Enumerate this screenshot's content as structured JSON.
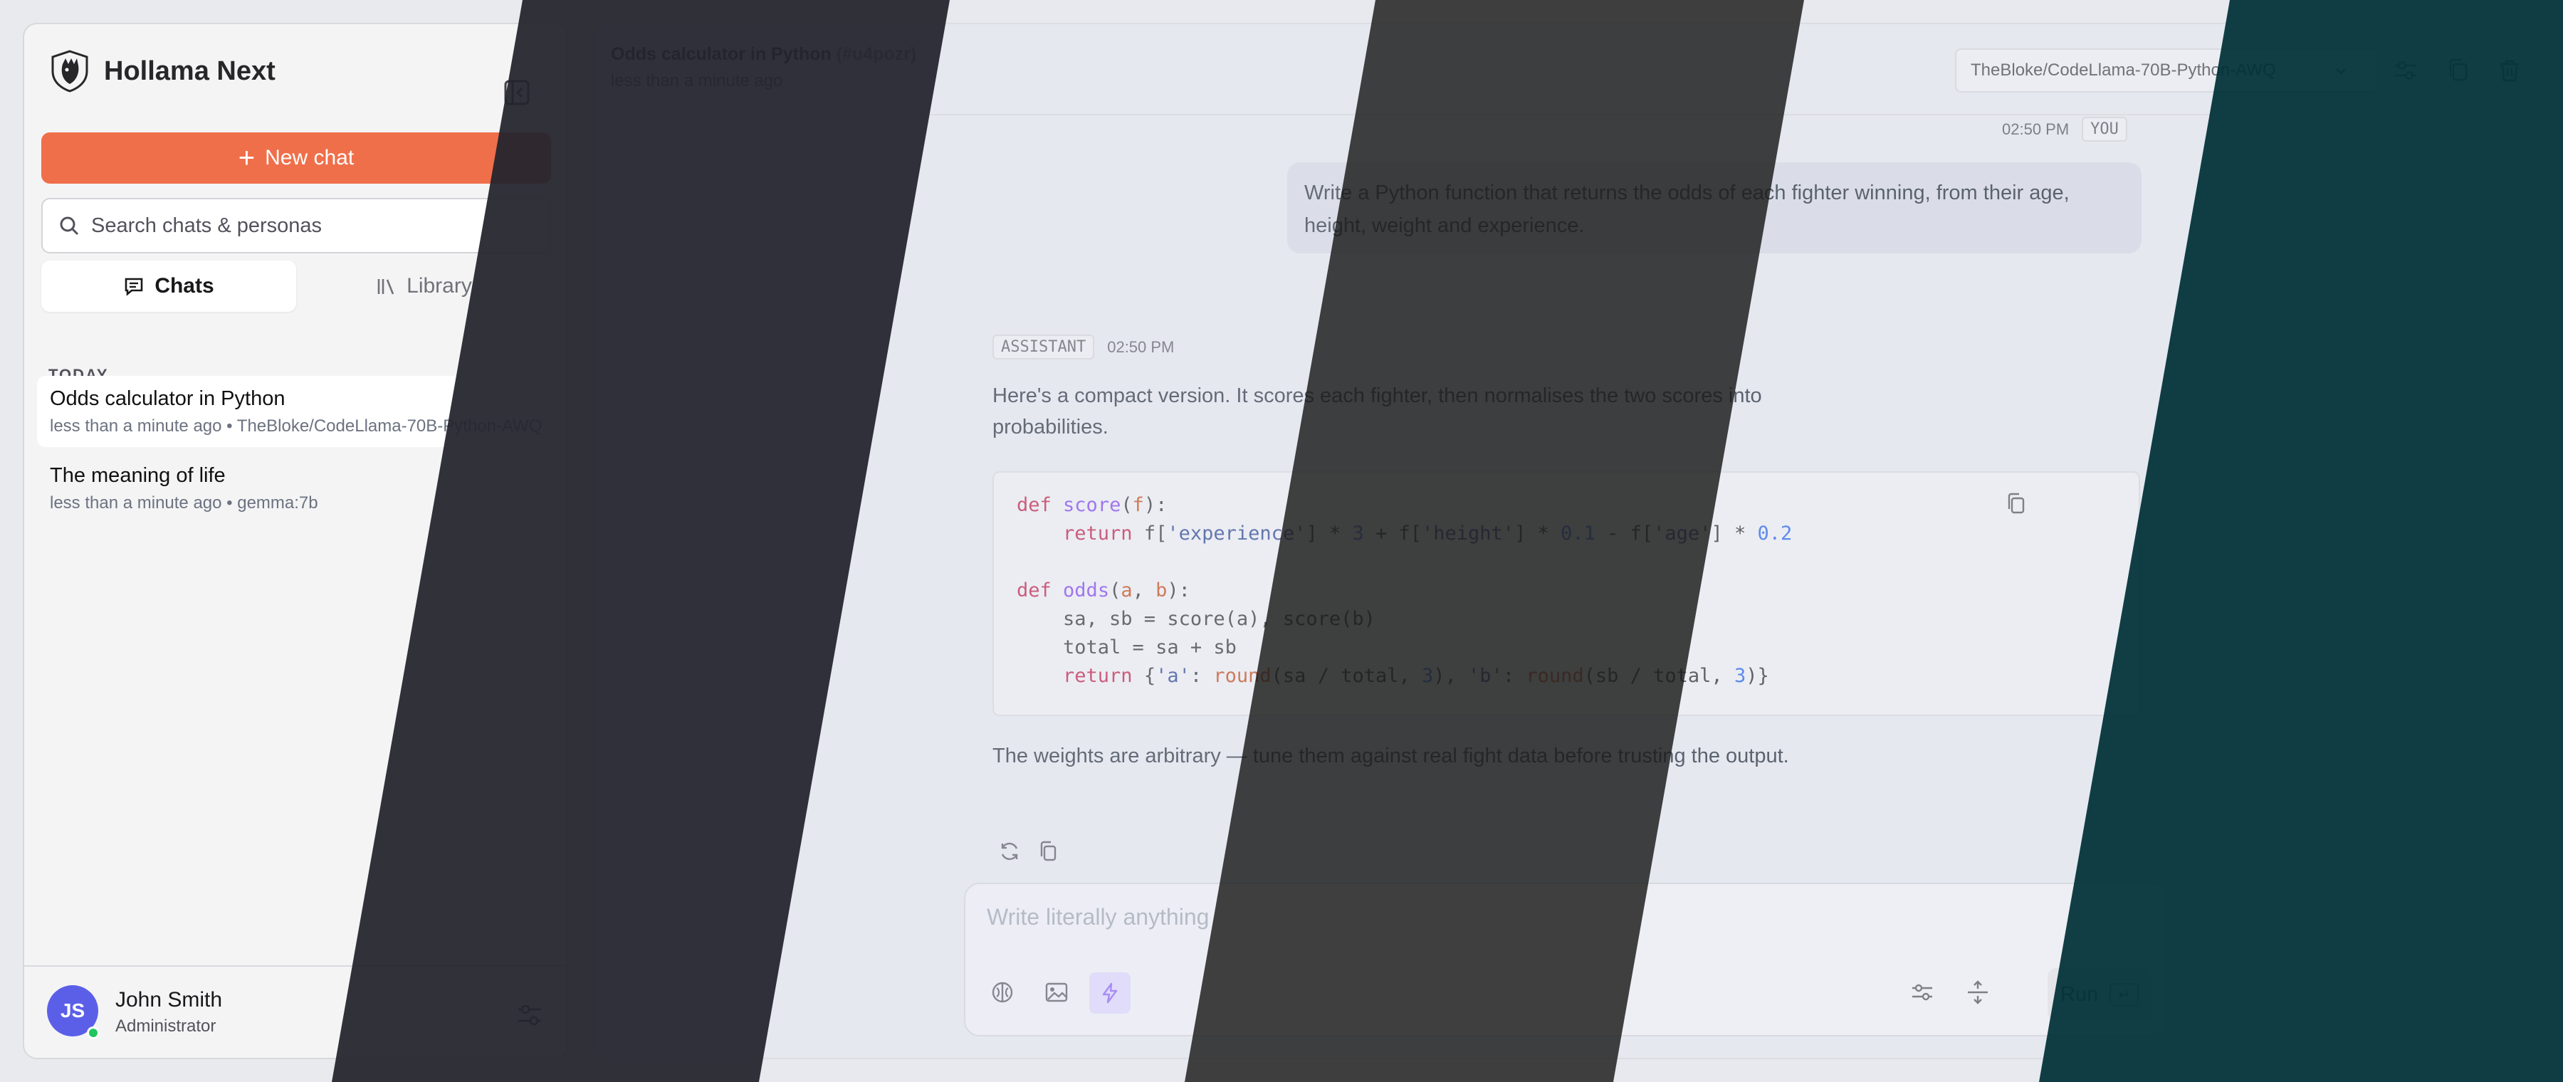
{
  "app": {
    "name": "Hollama Next"
  },
  "sidebar": {
    "new_chat_label": "New chat",
    "search_placeholder": "Search chats & personas",
    "tabs": [
      {
        "label": "Chats"
      },
      {
        "label": "Library"
      }
    ],
    "section_label": "TODAY",
    "chats": [
      {
        "title": "Odds calculator in Python",
        "subtitle": "less than a minute ago • TheBloke/CodeLlama-70B-Python-AWQ"
      },
      {
        "title": "The meaning of life",
        "subtitle": "less than a minute ago • gemma:7b"
      }
    ],
    "user": {
      "initials": "JS",
      "name": "John Smith",
      "role": "Administrator"
    }
  },
  "main": {
    "chat_title": "Odds calculator in Python",
    "chat_id": "(#u4pozr)",
    "chat_time": "less than a minute ago",
    "model": "TheBloke/CodeLlama-70B-Python-AWQ",
    "messages": {
      "user": {
        "time": "02:50 PM",
        "role": "YOU",
        "text": "Write a Python function that returns the odds of each fighter winning, from their age, height, weight and experience."
      },
      "assistant": {
        "role": "ASSISTANT",
        "time": "02:50 PM",
        "intro": "Here's a compact version. It scores each fighter, then normalises the two scores into probabilities.",
        "outro": "The weights are arbitrary — tune them against real fight data before trusting the output."
      }
    },
    "composer": {
      "placeholder": "Write literally anything",
      "run_label": "Run",
      "enter_key": "↵"
    }
  },
  "colors": {
    "accent": "#ef6f4a",
    "avatar": "#5b5fe8",
    "online": "#22c55e",
    "bands": [
      "#2b2b38",
      "#e6e8f0",
      "#2b2b2b",
      "#e6e8f0",
      "#073539"
    ]
  }
}
